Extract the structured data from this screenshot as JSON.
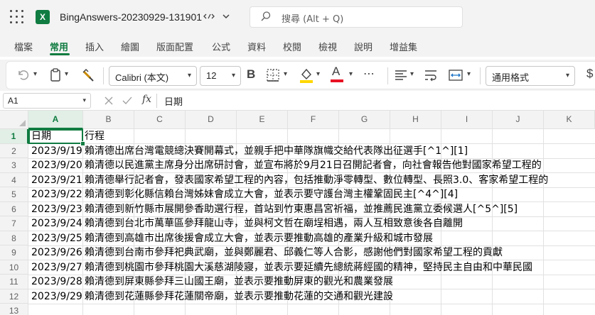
{
  "titlebar": {
    "doc_title": "BingAnswers-20230929-131901",
    "search_placeholder": "搜尋 (Alt + Q)",
    "app_logo": "X",
    "icons": [
      "waffle-icon",
      "excel-logo-icon",
      "save-status-icon",
      "chevron-down-icon",
      "search-icon"
    ]
  },
  "tabs": [
    {
      "label": "檔案"
    },
    {
      "label": "常用",
      "active": true
    },
    {
      "label": "插入"
    },
    {
      "label": "繪圖"
    },
    {
      "label": "版面配置"
    },
    {
      "label": "公式"
    },
    {
      "label": "資料"
    },
    {
      "label": "校閱"
    },
    {
      "label": "檢視"
    },
    {
      "label": "說明"
    },
    {
      "label": "增益集"
    }
  ],
  "ribbon": {
    "font_name": "Calibri (本文)",
    "font_size": "12",
    "bold_label": "B",
    "font_color_label": "A",
    "number_format": "通用格式",
    "currency_label": "$",
    "more_label": "⋯",
    "colors": {
      "highlight": "#ffd700",
      "font_color": "#e81123",
      "accent": "#107c41"
    }
  },
  "formula_bar": {
    "name_box": "A1",
    "fx_label": "fx",
    "value": "日期"
  },
  "columns": [
    "A",
    "B",
    "C",
    "D",
    "E",
    "F",
    "G",
    "H",
    "I",
    "J",
    "K"
  ],
  "selected_column": "A",
  "selected_row": "1",
  "rows": [
    {
      "num": "1",
      "a": "日期",
      "b": "行程",
      "a_text": true
    },
    {
      "num": "2",
      "a": "2023/9/19",
      "b": "賴清德出席台灣電競總決賽開幕式，並親手把中華隊旗幟交給代表隊出征選手[^1^][1]"
    },
    {
      "num": "3",
      "a": "2023/9/20",
      "b": "賴清德以民進黨主席身分出席研討會，並宣布將於9月21日召開記者會，向社會報告他對國家希望工程的"
    },
    {
      "num": "4",
      "a": "2023/9/21",
      "b": "賴清德舉行記者會，發表國家希望工程的內容，包括推動淨零轉型、數位轉型、長照3.0、客家希望工程的"
    },
    {
      "num": "5",
      "a": "2023/9/22",
      "b": "賴清德到彰化縣信賴台灣姊妹會成立大會，並表示要守護台灣主權鞏固民主[^4^][4]"
    },
    {
      "num": "6",
      "a": "2023/9/23",
      "b": "賴清德到新竹縣市展開參香助選行程，首站到竹東惠昌宮祈福，並推薦民進黨立委候選人[^5^][5]"
    },
    {
      "num": "7",
      "a": "2023/9/24",
      "b": "賴清德到台北市萬華區參拜龍山寺，並與柯文哲在廟埕相遇，兩人互相致意後各自離開"
    },
    {
      "num": "8",
      "a": "2023/9/25",
      "b": "賴清德到高雄市出席後援會成立大會，並表示要推動高雄的產業升級和城市發展"
    },
    {
      "num": "9",
      "a": "2023/9/26",
      "b": "賴清德到台南市參拜祀典武廟，並與鄭麗君、邱義仁等人合影，感謝他們對國家希望工程的貢獻"
    },
    {
      "num": "10",
      "a": "2023/9/27",
      "b": "賴清德到桃園市參拜桃園大溪慈湖陵寢，並表示要延續先總統蔣經國的精神，堅持民主自由和中華民國"
    },
    {
      "num": "11",
      "a": "2023/9/28",
      "b": "賴清德到屏東縣參拜三山國王廟，並表示要推動屏東的觀光和農業發展"
    },
    {
      "num": "12",
      "a": "2023/9/29",
      "b": "賴清德到花蓮縣參拜花蓮關帝廟，並表示要推動花蓮的交通和觀光建設"
    },
    {
      "num": "13",
      "a": "",
      "b": ""
    }
  ]
}
